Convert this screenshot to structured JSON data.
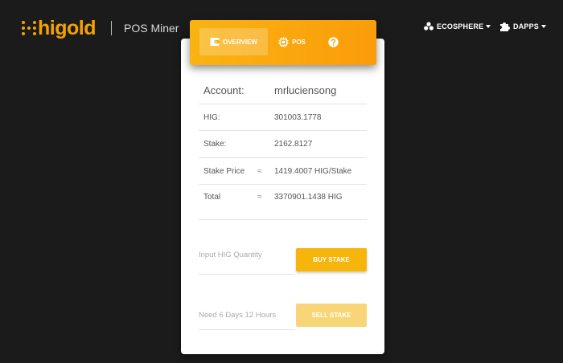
{
  "header": {
    "logo_text": "higold",
    "app_title": "POS Miner",
    "nav": [
      {
        "label": "ECOSPHERE",
        "icon": "ecosphere-icon"
      },
      {
        "label": "DAPPS",
        "icon": "puzzle-icon"
      }
    ]
  },
  "tabs": [
    {
      "label": "OVERVIEW",
      "icon": "wallet-icon",
      "active": true
    },
    {
      "label": "POS",
      "icon": "chip-icon",
      "active": false
    },
    {
      "label": "",
      "icon": "help-icon",
      "active": false
    }
  ],
  "account": {
    "label": "Account:",
    "value": "mrluciensong"
  },
  "rows": [
    {
      "label": "HIG:",
      "approx": "",
      "value": "301003.1778"
    },
    {
      "label": "Stake:",
      "approx": "",
      "value": "2162.8127"
    },
    {
      "label": "Stake Price",
      "approx": "≈",
      "value": "1419.4007 HIG/Stake"
    },
    {
      "label": "Total",
      "approx": "≈",
      "value": "3370901.1438 HIG"
    }
  ],
  "buy": {
    "placeholder": "Input HIG Quantity",
    "button": "BUY STAKE"
  },
  "sell": {
    "notice": "Need 6 Days 12 Hours",
    "button": "SELL STAKE"
  },
  "colors": {
    "brand": "#f5a200",
    "button": "#f5b50a",
    "button_disabled": "#f8d677",
    "background": "#1b1b1b"
  }
}
